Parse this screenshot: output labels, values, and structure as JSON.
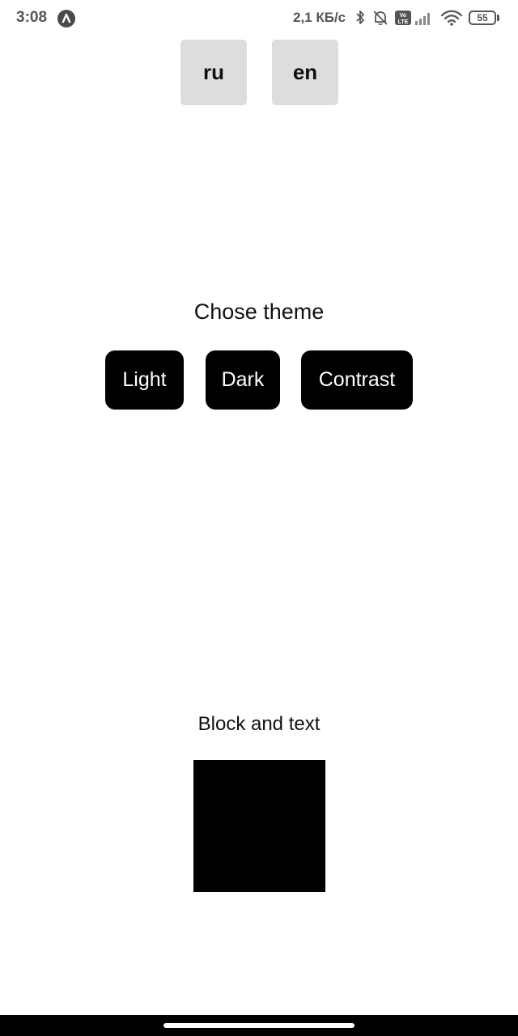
{
  "status_bar": {
    "time": "3:08",
    "network_speed": "2,1 КБ/с",
    "battery_level": "55",
    "icons": [
      "app-badge-icon",
      "bluetooth-icon",
      "bell-off-icon",
      "volte-icon",
      "signal-icon",
      "wifi-icon",
      "battery-icon"
    ]
  },
  "language": {
    "ru_label": "ru",
    "en_label": "en"
  },
  "theme": {
    "title": "Chose theme",
    "light_label": "Light",
    "dark_label": "Dark",
    "contrast_label": "Contrast"
  },
  "block": {
    "title": "Block and text",
    "color": "#000000"
  },
  "colors": {
    "button_background": "#dddddd",
    "theme_button_background": "#000000",
    "theme_button_text": "#ffffff"
  }
}
